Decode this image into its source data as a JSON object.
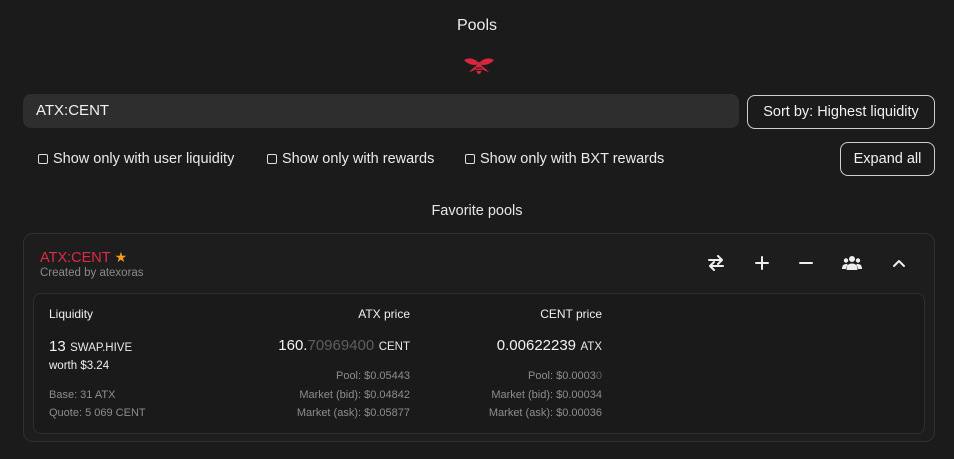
{
  "page": {
    "title": "Pools"
  },
  "search": {
    "value": "ATX:CENT"
  },
  "sort": {
    "label": "Sort by: Highest liquidity"
  },
  "filters": [
    {
      "label": "Show only with user liquidity",
      "checked": false
    },
    {
      "label": "Show only with rewards",
      "checked": false
    },
    {
      "label": "Show only with BXT rewards",
      "checked": false
    }
  ],
  "expand_all": {
    "label": "Expand all"
  },
  "favorites": {
    "heading": "Favorite pools"
  },
  "pool": {
    "name": "ATX:CENT",
    "favorite": true,
    "created_by": "Created by atexoras",
    "actions": [
      "swap-icon",
      "add-icon",
      "remove-icon",
      "users-icon",
      "collapse-icon"
    ],
    "liquidity": {
      "header": "Liquidity",
      "amount": "13",
      "unit": "SWAP.HIVE",
      "worth": "worth $3.24",
      "base": "Base: 31 ATX",
      "quote": "Quote: 5 069 CENT"
    },
    "atx_price": {
      "header": "ATX price",
      "value_main": "160.",
      "value_dim": "70969400",
      "unit": "CENT",
      "pool": "Pool: $0.05443",
      "market_bid": "Market (bid): $0.04842",
      "market_ask": "Market (ask): $0.05877"
    },
    "cent_price": {
      "header": "CENT price",
      "value": "0.00622239",
      "unit": "ATX",
      "pool_main": "Pool: $0.0003",
      "pool_dim": "0",
      "market_bid": "Market (bid): $0.00034",
      "market_ask": "Market (ask): $0.00036"
    }
  },
  "colors": {
    "accent": "#e02a45",
    "star": "#f29b1c",
    "background": "#1b1b1b"
  }
}
